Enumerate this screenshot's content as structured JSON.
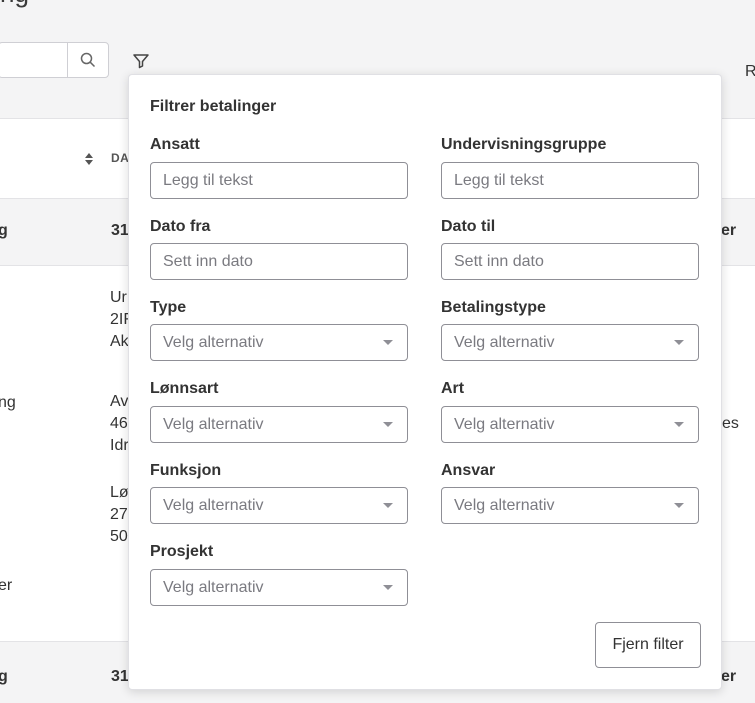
{
  "page": {
    "title_partial": "ng"
  },
  "toolbar": {
    "search_input_value": "",
    "right_clip": "R"
  },
  "table": {
    "header_partial": "DA",
    "rows": [
      {
        "c1": "g",
        "c2": "31",
        "c3": "er"
      },
      {
        "lines": [
          "Ur",
          "2IF",
          "Ak"
        ],
        "c1": "ng",
        "lines2": [
          "Av",
          "46",
          "Idr"
        ],
        "lines3": [
          "Lø",
          "27",
          "50"
        ],
        "c3": "es",
        "c1b": "er"
      },
      {
        "c1": "g",
        "c2": "31",
        "c3": "er"
      }
    ]
  },
  "filter_panel": {
    "title": "Filtrer betalinger",
    "fields": {
      "ansatt": {
        "label": "Ansatt",
        "placeholder": "Legg til tekst"
      },
      "undervisningsgruppe": {
        "label": "Undervisningsgruppe",
        "placeholder": "Legg til tekst"
      },
      "dato_fra": {
        "label": "Dato fra",
        "placeholder": "Sett inn dato"
      },
      "dato_til": {
        "label": "Dato til",
        "placeholder": "Sett inn dato"
      },
      "type": {
        "label": "Type",
        "value": "Velg alternativ"
      },
      "betalingstype": {
        "label": "Betalingstype",
        "value": "Velg alternativ"
      },
      "lonnsart": {
        "label": "Lønnsart",
        "value": "Velg alternativ"
      },
      "art": {
        "label": "Art",
        "value": "Velg alternativ"
      },
      "funksjon": {
        "label": "Funksjon",
        "value": "Velg alternativ"
      },
      "ansvar": {
        "label": "Ansvar",
        "value": "Velg alternativ"
      },
      "prosjekt": {
        "label": "Prosjekt",
        "value": "Velg alternativ"
      }
    },
    "clear_button": "Fjern filter"
  }
}
